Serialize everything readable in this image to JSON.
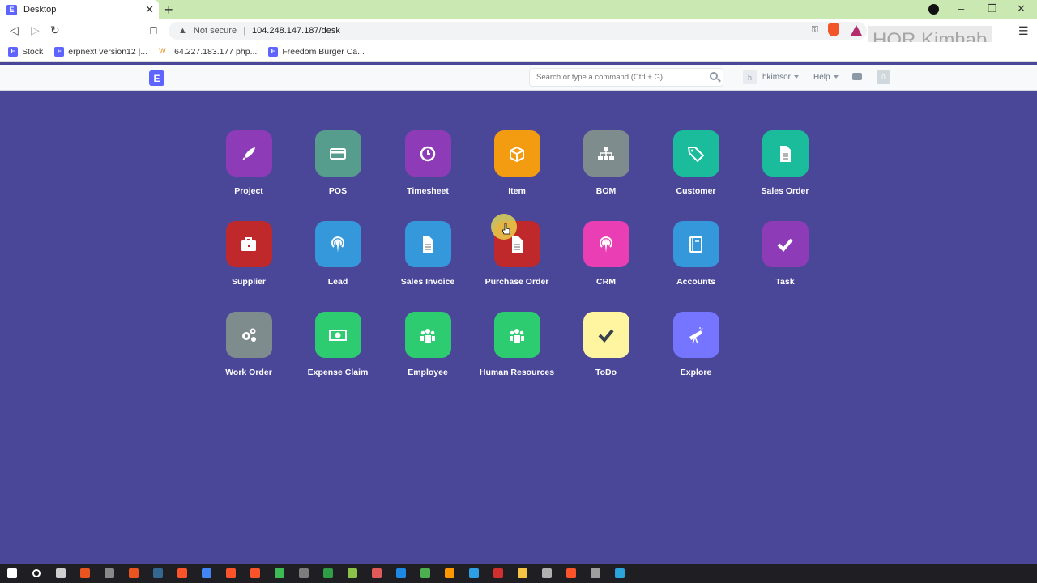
{
  "browser": {
    "tab_title": "Desktop",
    "tab_favicon": "E",
    "address_security": "Not secure",
    "address_url": "104.248.147.187/desk",
    "watermark": "HOR Kimhab",
    "bookmarks": [
      {
        "icon": "E",
        "label": "Stock"
      },
      {
        "icon": "E",
        "label": "erpnext version12 |..."
      },
      {
        "icon": "W",
        "label": "64.227.183.177 php..."
      },
      {
        "icon": "E",
        "label": "Freedom Burger Ca..."
      }
    ]
  },
  "navbar": {
    "logo": "E",
    "search_placeholder": "Search or type a command (Ctrl + G)",
    "avatar": "h",
    "user": "hkimsor",
    "help": "Help",
    "notification": "0"
  },
  "desktop": {
    "icons": [
      {
        "label": "Project",
        "color": "#8e3bb8",
        "icon": "rocket-icon"
      },
      {
        "label": "POS",
        "color": "#569d8d",
        "icon": "credit-card-icon"
      },
      {
        "label": "Timesheet",
        "color": "#8e3bb8",
        "icon": "clock-icon"
      },
      {
        "label": "Item",
        "color": "#f39c12",
        "icon": "box-icon"
      },
      {
        "label": "BOM",
        "color": "#7f8c8d",
        "icon": "sitemap-icon"
      },
      {
        "label": "Customer",
        "color": "#1abc9c",
        "icon": "tag-icon"
      },
      {
        "label": "Sales Order",
        "color": "#1abc9c",
        "icon": "file-icon"
      },
      {
        "label": "Supplier",
        "color": "#c0292b",
        "icon": "briefcase-icon"
      },
      {
        "label": "Lead",
        "color": "#3498db",
        "icon": "broadcast-icon"
      },
      {
        "label": "Sales Invoice",
        "color": "#3498db",
        "icon": "file-icon"
      },
      {
        "label": "Purchase Order",
        "color": "#c0292b",
        "icon": "file-icon"
      },
      {
        "label": "CRM",
        "color": "#ea3eb4",
        "icon": "broadcast-icon"
      },
      {
        "label": "Accounts",
        "color": "#3498db",
        "icon": "book-icon"
      },
      {
        "label": "Task",
        "color": "#8e3bb8",
        "icon": "check-icon"
      },
      {
        "label": "Work Order",
        "color": "#7f8c8d",
        "icon": "gears-icon"
      },
      {
        "label": "Expense Claim",
        "color": "#2ecc71",
        "icon": "money-icon"
      },
      {
        "label": "Employee",
        "color": "#2ecc71",
        "icon": "group-icon"
      },
      {
        "label": "Human Resources",
        "color": "#2ecc71",
        "icon": "group-icon"
      },
      {
        "label": "ToDo",
        "color": "#fff5a0",
        "icon": "check-icon"
      },
      {
        "label": "Explore",
        "color": "#7575ff",
        "icon": "telescope-icon"
      }
    ]
  },
  "taskbar": {
    "apps": [
      "windows-start-icon",
      "search-icon",
      "file-icon",
      "ubuntu-icon",
      "terminal-icon",
      "ubuntu-icon",
      "postgres-icon",
      "brave-icon",
      "chrome-icon",
      "brave-icon",
      "brave-icon",
      "app-icon",
      "app-icon",
      "app-icon",
      "app-icon",
      "app-icon",
      "app-icon",
      "app-icon",
      "app-icon",
      "vscode-icon",
      "app-icon",
      "folder-icon",
      "app-icon",
      "brave-icon",
      "app-icon",
      "telegram-icon"
    ]
  }
}
